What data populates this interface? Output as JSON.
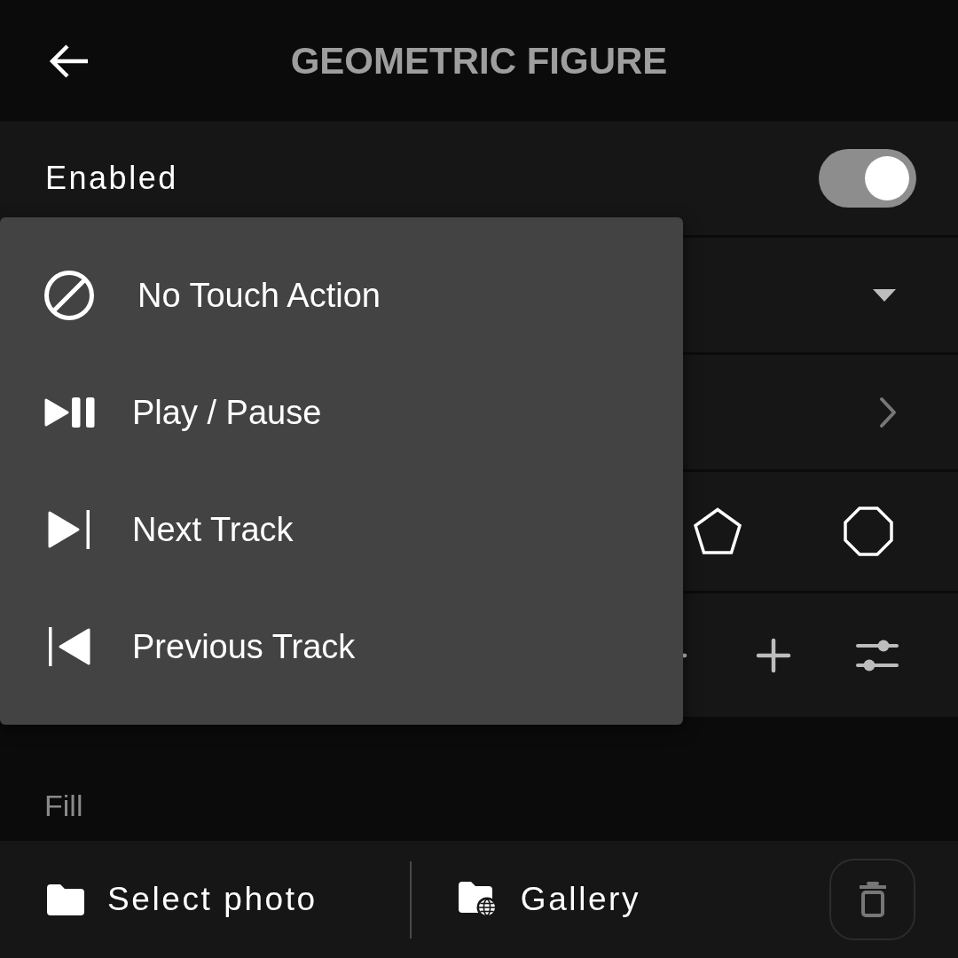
{
  "header": {
    "title": "GEOMETRIC FIGURE"
  },
  "settings": {
    "enabled": {
      "label": "Enabled",
      "on": true
    },
    "rows": [
      {
        "kind": "dropdown"
      },
      {
        "kind": "link"
      },
      {
        "kind": "shapes"
      },
      {
        "kind": "stepper"
      }
    ]
  },
  "touch_action_menu": {
    "items": [
      {
        "label": "No Touch Action",
        "kind": "none"
      },
      {
        "label": "Play / Pause",
        "kind": "play_pause"
      },
      {
        "label": "Next Track",
        "kind": "next"
      },
      {
        "label": "Previous Track",
        "kind": "previous"
      }
    ]
  },
  "fill": {
    "label": "Fill",
    "sources": [
      {
        "label": "Select photo",
        "kind": "folder"
      },
      {
        "label": "Gallery",
        "kind": "gallery"
      }
    ]
  }
}
